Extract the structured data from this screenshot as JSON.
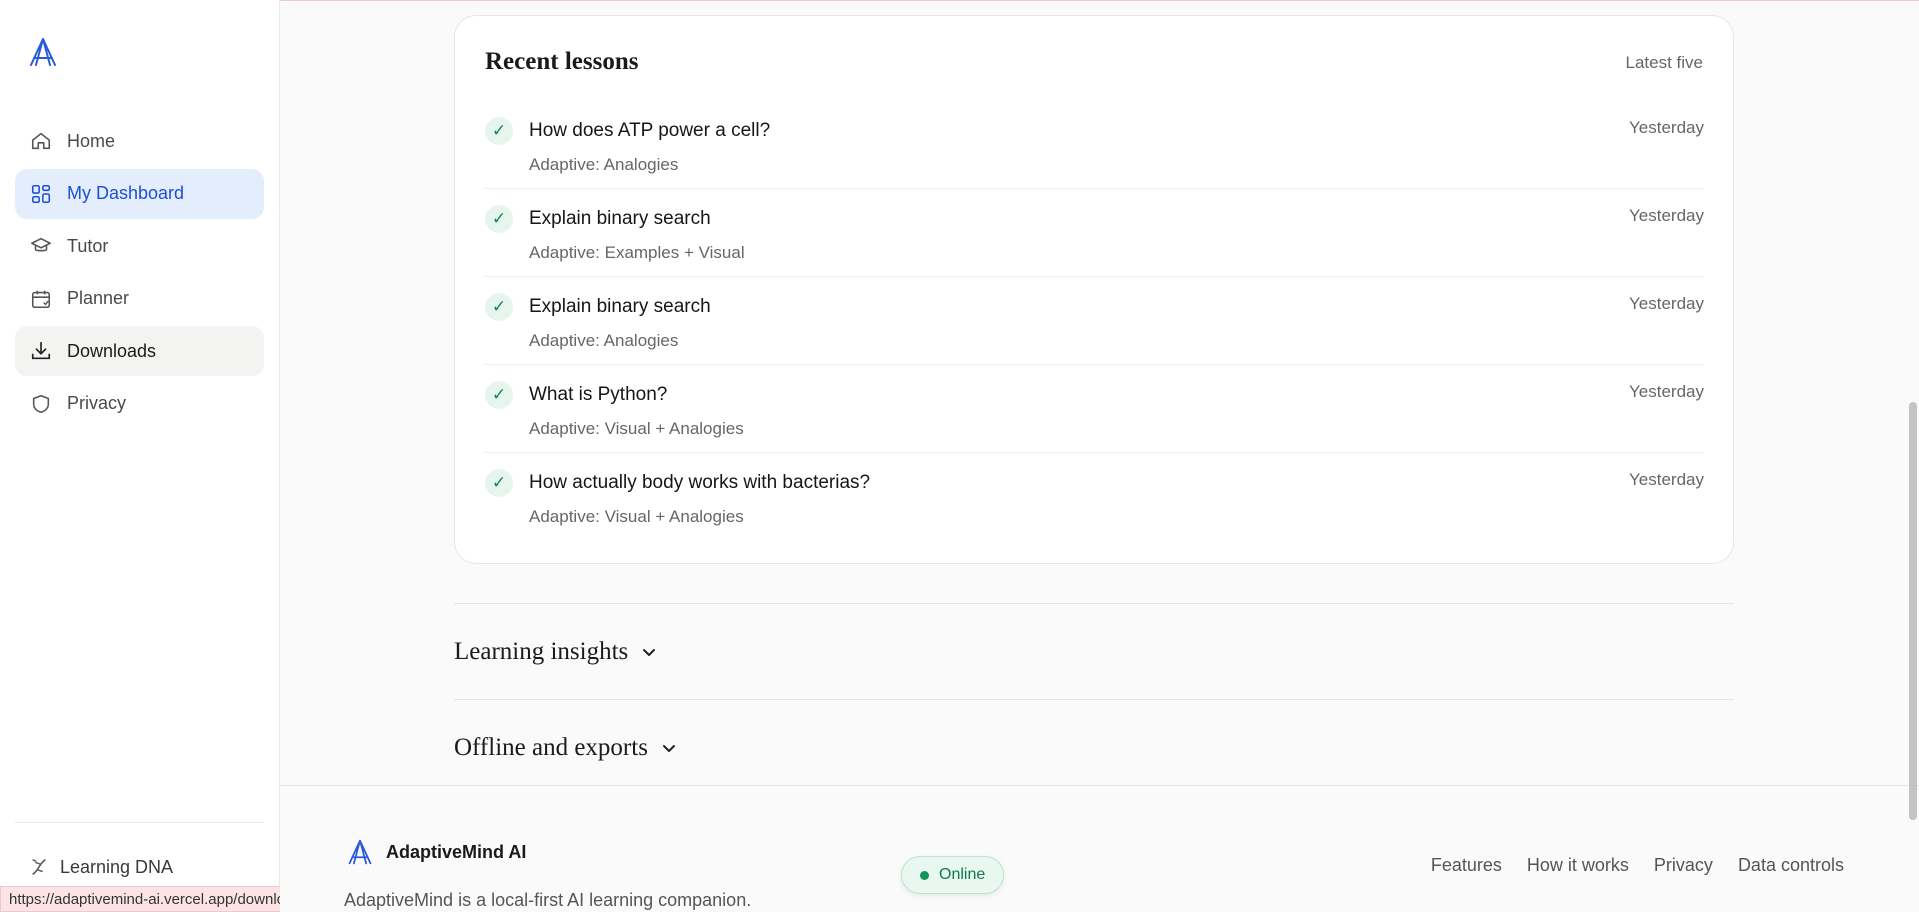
{
  "sidebar": {
    "nav": [
      {
        "label": "Home",
        "icon": "home-icon"
      },
      {
        "label": "My Dashboard",
        "icon": "dashboard-icon"
      },
      {
        "label": "Tutor",
        "icon": "graduation-cap-icon"
      },
      {
        "label": "Planner",
        "icon": "calendar-icon"
      },
      {
        "label": "Downloads",
        "icon": "download-icon"
      },
      {
        "label": "Privacy",
        "icon": "shield-icon"
      }
    ],
    "active": "My Dashboard",
    "hovered": "Downloads",
    "dna_label": "Learning DNA"
  },
  "status_url": "https://adaptivemind-ai.vercel.app/downloads",
  "recent": {
    "title": "Recent lessons",
    "note": "Latest five",
    "lessons": [
      {
        "title": "How does ATP power a cell?",
        "sub": "Adaptive: Analogies",
        "time": "Yesterday"
      },
      {
        "title": "Explain binary search",
        "sub": "Adaptive: Examples + Visual",
        "time": "Yesterday"
      },
      {
        "title": "Explain binary search",
        "sub": "Adaptive: Analogies",
        "time": "Yesterday"
      },
      {
        "title": "What is Python?",
        "sub": "Adaptive: Visual + Analogies",
        "time": "Yesterday"
      },
      {
        "title": "How actually body works with bacterias?",
        "sub": "Adaptive: Visual + Analogies",
        "time": "Yesterday"
      }
    ]
  },
  "sections": {
    "insights": "Learning insights",
    "offline": "Offline and exports"
  },
  "footer": {
    "brand": "AdaptiveMind AI",
    "tagline": "AdaptiveMind is a local-first AI learning companion.",
    "links": [
      "Features",
      "How it works",
      "Privacy",
      "Data controls"
    ],
    "online": "Online"
  },
  "colors": {
    "accent": "#1d4fd8",
    "success": "#0f8a52"
  }
}
